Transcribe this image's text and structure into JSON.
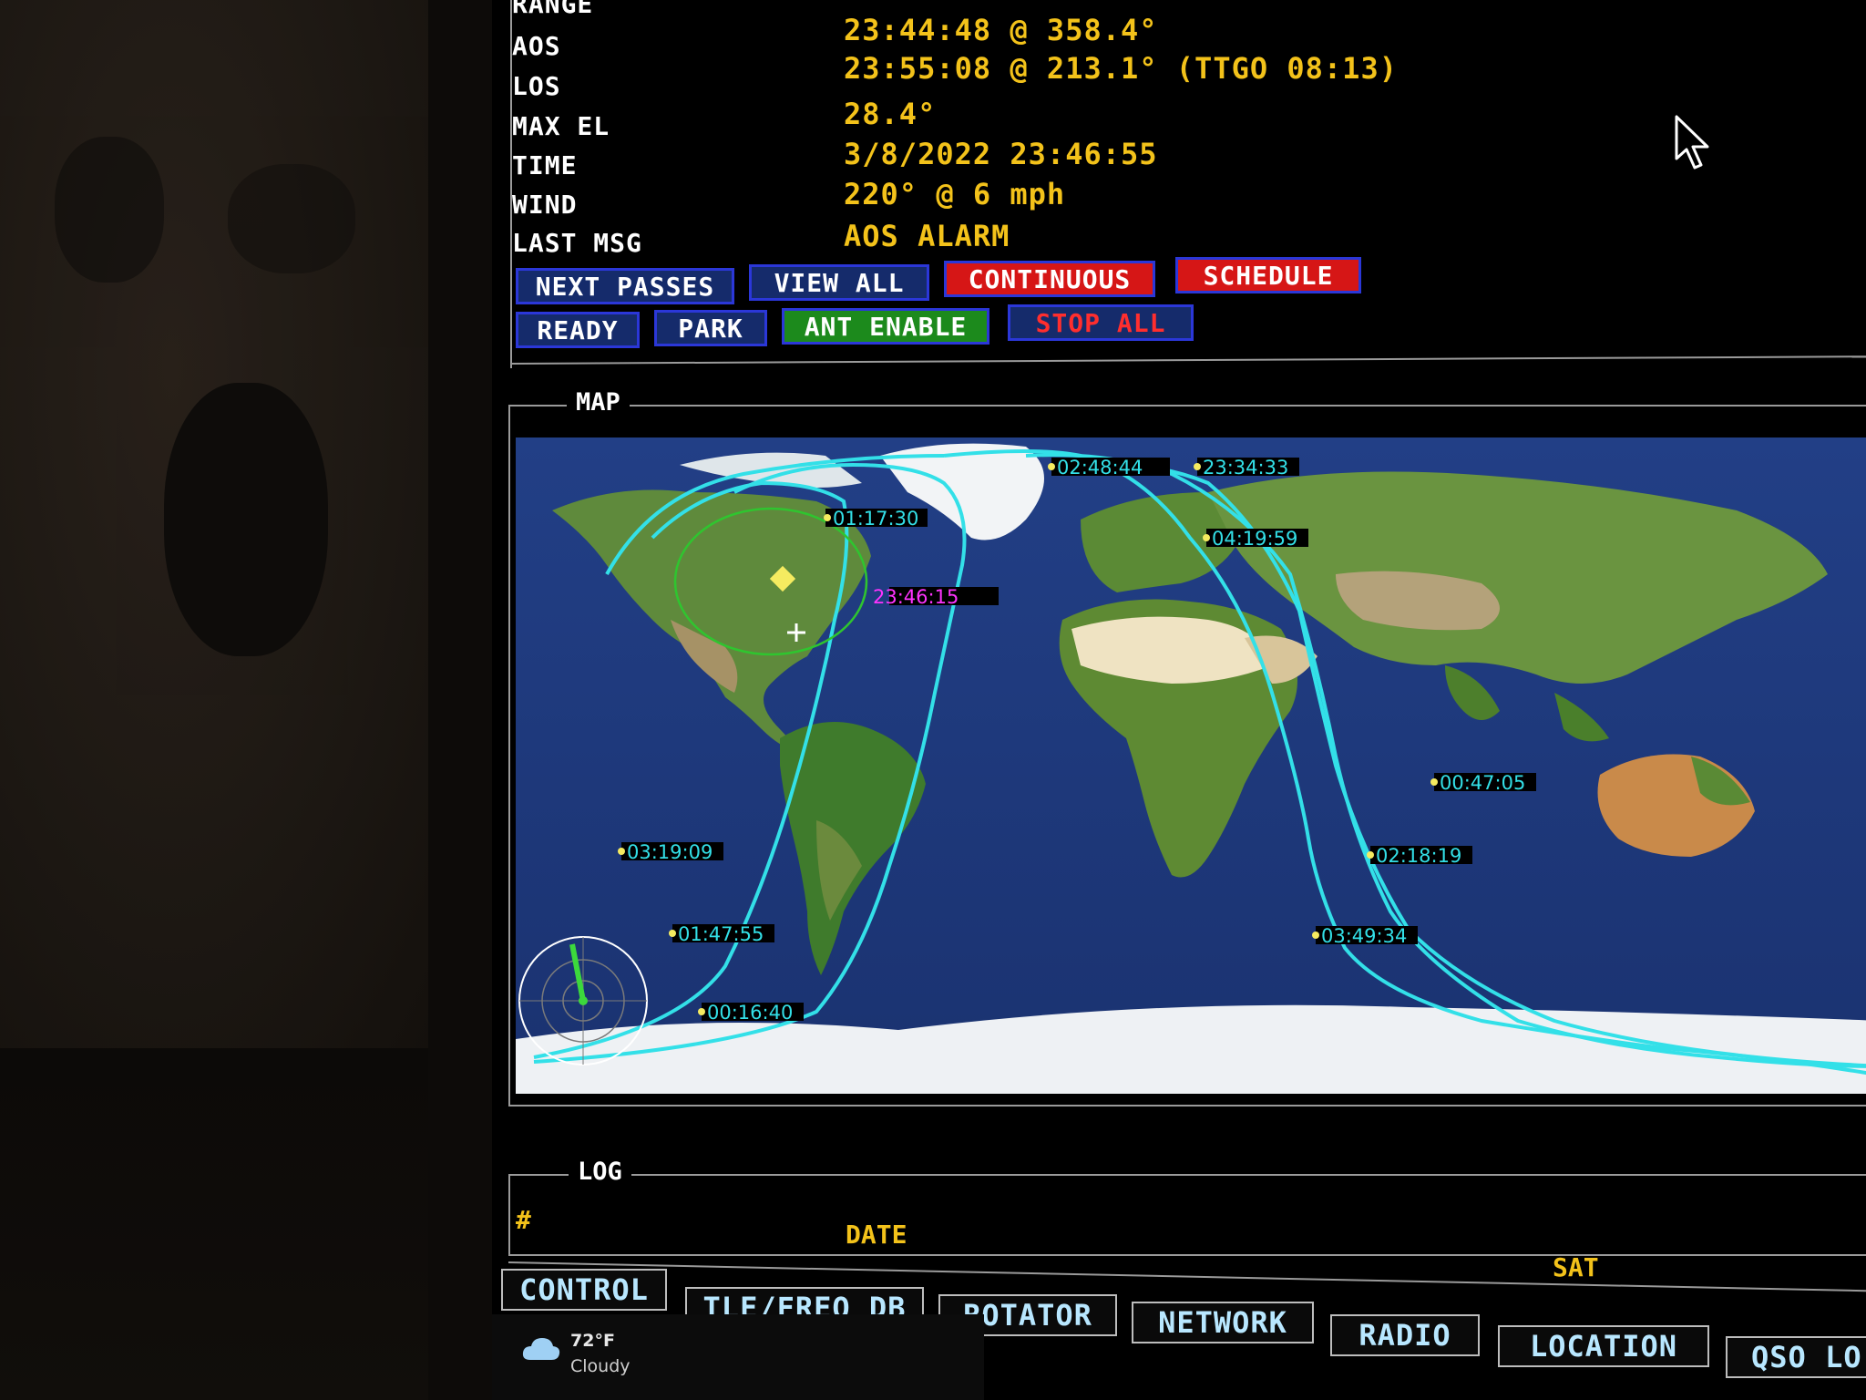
{
  "status": {
    "rows": [
      {
        "label": "RANGE",
        "value": ""
      },
      {
        "label": "AOS",
        "value": "23:44:48 @ 358.4°"
      },
      {
        "label": "LOS",
        "value": "23:55:08 @ 213.1° (TTGO 08:13)"
      },
      {
        "label": "MAX EL",
        "value": "28.4°"
      },
      {
        "label": "TIME",
        "value": "3/8/2022 23:46:55"
      },
      {
        "label": "WIND",
        "value": "220° @ 6 mph"
      },
      {
        "label": "LAST MSG",
        "value": "AOS ALARM"
      }
    ]
  },
  "controls": {
    "next_passes": "NEXT PASSES",
    "view_all": "VIEW ALL",
    "continuous": "CONTINUOUS",
    "schedule": "SCHEDULE",
    "ready": "READY",
    "park": "PARK",
    "ant_enable": "ANT ENABLE",
    "stop_all": "STOP ALL"
  },
  "map": {
    "title": "MAP",
    "current_time": "23:46:15",
    "track_labels": [
      "02:48:44",
      "23:34:33",
      "01:17:30",
      "04:19:59",
      "00:47:05",
      "03:19:09",
      "02:18:19",
      "01:47:55",
      "03:49:34",
      "00:16:40"
    ]
  },
  "log": {
    "title": "LOG",
    "columns": {
      "number": "#",
      "date": "DATE",
      "sat": "SAT"
    }
  },
  "tabs": [
    "CONTROL",
    "TLE/FREQ DB",
    "ROTATOR",
    "NETWORK",
    "RADIO",
    "LOCATION",
    "QSO LO"
  ],
  "weather": {
    "temp": "72°F",
    "condition": "Cloudy",
    "icon": "cloud-icon"
  },
  "colors": {
    "track": "#33e0e8",
    "current": "#ff33ff",
    "label": "#f3c21a",
    "button_border": "#2b37d8"
  }
}
